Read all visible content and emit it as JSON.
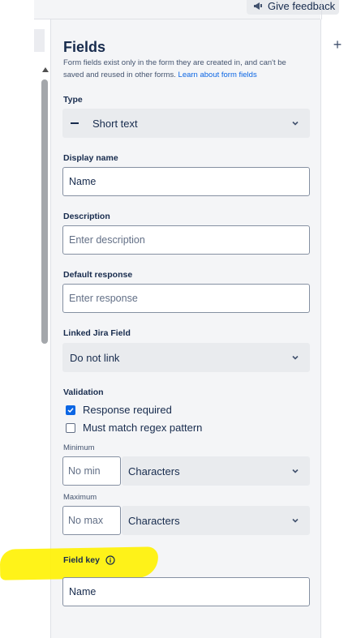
{
  "header": {
    "feedback_label": "Give feedback"
  },
  "panel": {
    "title": "Fields",
    "description": "Form fields exist only in the form they are created in, and can't be saved and reused in other forms.",
    "learn_link": "Learn about form fields",
    "type": {
      "label": "Type",
      "value": "Short text"
    },
    "display_name": {
      "label": "Display name",
      "value": "Name"
    },
    "description_field": {
      "label": "Description",
      "placeholder": "Enter description"
    },
    "default_response": {
      "label": "Default response",
      "placeholder": "Enter response"
    },
    "linked_jira": {
      "label": "Linked Jira Field",
      "value": "Do not link"
    },
    "validation": {
      "label": "Validation",
      "options": [
        {
          "label": "Response required",
          "checked": true
        },
        {
          "label": "Must match regex pattern",
          "checked": false
        }
      ]
    },
    "minimum": {
      "label": "Minimum",
      "placeholder": "No min",
      "unit": "Characters"
    },
    "maximum": {
      "label": "Maximum",
      "placeholder": "No max",
      "unit": "Characters"
    },
    "field_key": {
      "label": "Field key",
      "value": "Name"
    }
  },
  "colors": {
    "accent": "#0c66e4",
    "highlight": "#fff200",
    "panel_bg": "#f4f5f7"
  },
  "icons": {
    "feedback": "megaphone-icon",
    "add": "plus-icon",
    "info": "info-icon",
    "chevron": "chevron-down-icon"
  }
}
